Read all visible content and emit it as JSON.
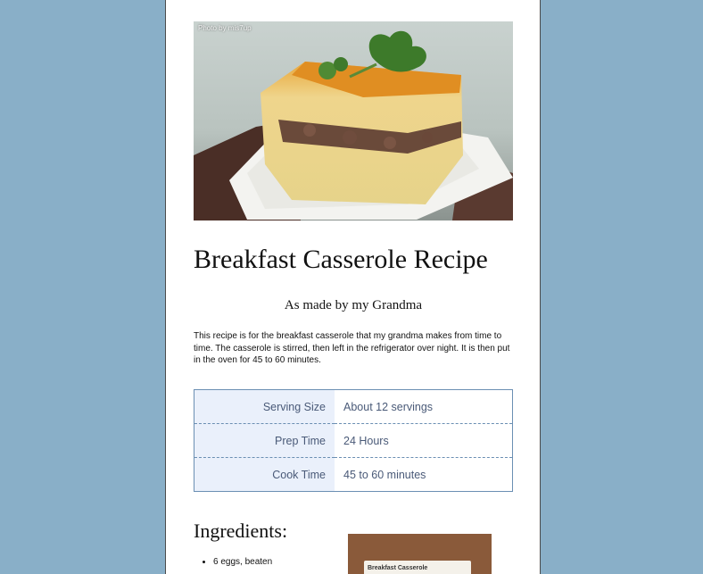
{
  "hero": {
    "credit": "Photo by mis7up"
  },
  "recipe": {
    "title": "Breakfast Casserole Recipe",
    "subtitle": "As made by my Grandma",
    "intro": "This recipe is for the breakfast casserole that my grandma makes from time to time. The casserole is stirred, then left in the refrigerator over night. It is then put in the oven for 45 to 60 minutes."
  },
  "facts": [
    {
      "label": "Serving Size",
      "value": "About 12 servings"
    },
    {
      "label": "Prep Time",
      "value": "24 Hours"
    },
    {
      "label": "Cook Time",
      "value": "45 to 60 minutes"
    }
  ],
  "ingredients": {
    "heading": "Ingredients:",
    "items": [
      "6 eggs, beaten"
    ]
  },
  "thumbnail": {
    "card_text": "Breakfast Casserole"
  },
  "colors": {
    "background": "#89afc8",
    "table_border": "#6b8fb3",
    "table_label_bg": "#eaf0fb",
    "table_text": "#4a5a78"
  }
}
